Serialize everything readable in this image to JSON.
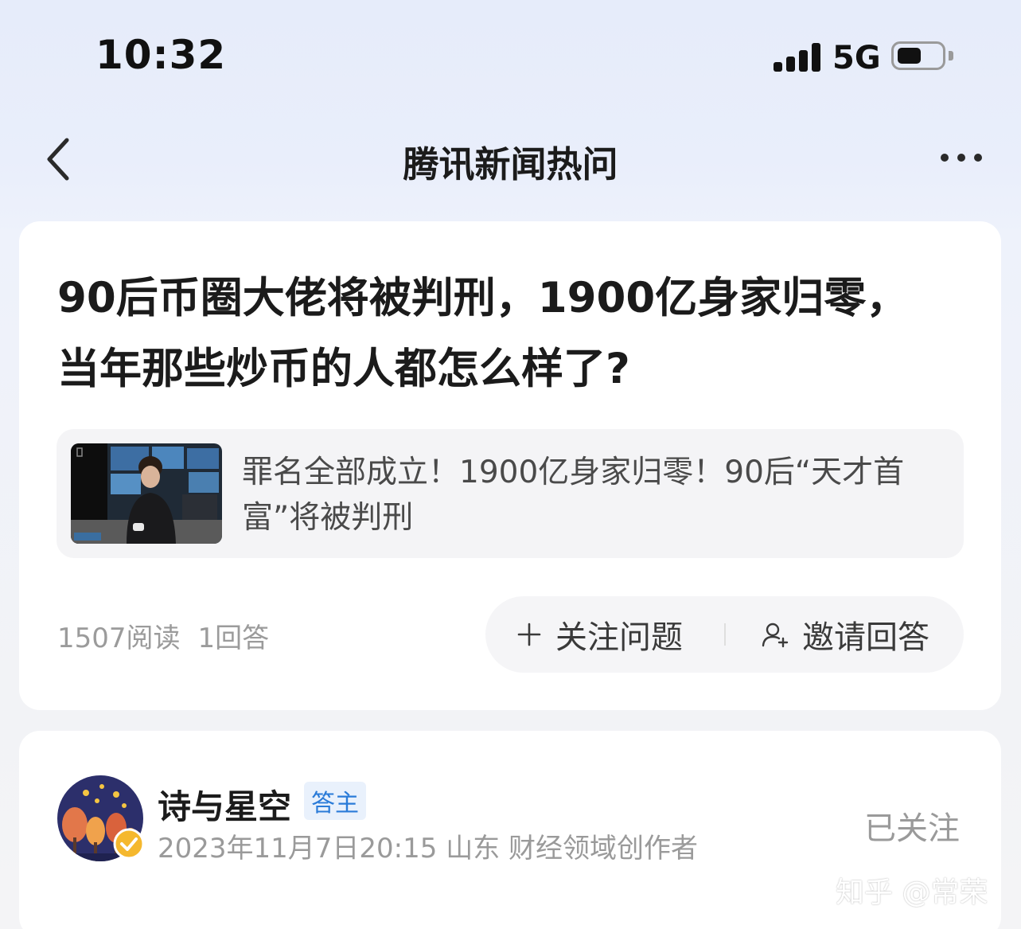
{
  "status_bar": {
    "time": "10:32",
    "network": "5G",
    "battery_level": 0.55
  },
  "nav": {
    "title": "腾讯新闻热问"
  },
  "question": {
    "title": "90后币圈大佬将被判刑，1900亿身家归零，当年那些炒币的人都怎么样了?",
    "news_card": {
      "text": "罪名全部成立！1900亿身家归零！90后“天才首富”将被判刑"
    },
    "stats": {
      "reads": "1507阅读",
      "answers": "1回答"
    },
    "actions": {
      "follow_label": "关注问题",
      "invite_label": "邀请回答"
    }
  },
  "answer": {
    "author_name": "诗与星空",
    "author_badge": "答主",
    "meta": "2023年11月7日20:15 山东 财经领域创作者",
    "follow_status": "已关注"
  },
  "watermark": "知乎 @常荣",
  "colors": {
    "badge_blue": "#2a7bd8",
    "verified_gold": "#f5b82e",
    "avatar_bg": "#2c2f6b"
  }
}
